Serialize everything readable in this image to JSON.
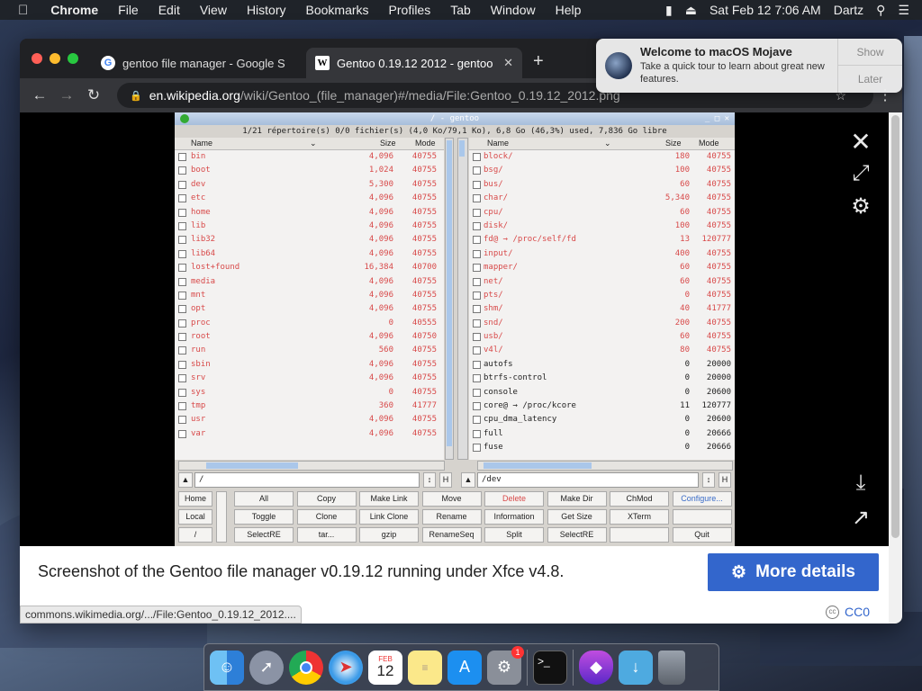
{
  "menubar": {
    "app": "Chrome",
    "items": [
      "File",
      "Edit",
      "View",
      "History",
      "Bookmarks",
      "Profiles",
      "Tab",
      "Window",
      "Help"
    ],
    "clock": "Sat Feb 12  7:06 AM",
    "user": "Dartz"
  },
  "browser": {
    "tabs": [
      {
        "title": "gentoo file manager - Google S",
        "favicon": "G"
      },
      {
        "title": "Gentoo 0.19.12 2012 - gentoo",
        "favicon": "W"
      }
    ],
    "url_host": "en.wikipedia.org",
    "url_path": "/wiki/Gentoo_(file_manager)#/media/File:Gentoo_0.19.12_2012.png"
  },
  "viewer": {
    "caption": "Screenshot of the Gentoo file manager v0.19.12 running under Xfce v4.8.",
    "more_details": "More details",
    "license": "CC0",
    "status_url": "commons.wikimedia.org/.../File:Gentoo_0.19.12_2012...."
  },
  "notification": {
    "title": "Welcome to macOS Mojave",
    "body": "Take a quick tour to learn about great new features.",
    "show": "Show",
    "later": "Later"
  },
  "gentoo": {
    "title": "/ - gentoo",
    "info": "1/21 répertoire(s) 0/0 fichier(s) (4,0 Ko/79,1 Ko), 6,8 Go (46,3%) used, 7,836 Go libre",
    "col_name": "Name",
    "col_size": "Size",
    "col_mode": "Mode",
    "left_path": "/",
    "right_path": "/dev",
    "h_label": "H",
    "left_files": [
      [
        "bin",
        "4,096",
        "40755"
      ],
      [
        "boot",
        "1,024",
        "40755"
      ],
      [
        "dev",
        "5,300",
        "40755"
      ],
      [
        "etc",
        "4,096",
        "40755"
      ],
      [
        "home",
        "4,096",
        "40755"
      ],
      [
        "lib",
        "4,096",
        "40755"
      ],
      [
        "lib32",
        "4,096",
        "40755"
      ],
      [
        "lib64",
        "4,096",
        "40755"
      ],
      [
        "lost+found",
        "16,384",
        "40700"
      ],
      [
        "media",
        "4,096",
        "40755"
      ],
      [
        "mnt",
        "4,096",
        "40755"
      ],
      [
        "opt",
        "4,096",
        "40755"
      ],
      [
        "proc",
        "0",
        "40555"
      ],
      [
        "root",
        "4,096",
        "40750"
      ],
      [
        "run",
        "560",
        "40755"
      ],
      [
        "sbin",
        "4,096",
        "40755"
      ],
      [
        "srv",
        "4,096",
        "40755"
      ],
      [
        "sys",
        "0",
        "40755"
      ],
      [
        "tmp",
        "360",
        "41777"
      ],
      [
        "usr",
        "4,096",
        "40755"
      ],
      [
        "var",
        "4,096",
        "40755"
      ]
    ],
    "right_files": [
      [
        "block/",
        "180",
        "40755",
        "r"
      ],
      [
        "bsg/",
        "100",
        "40755",
        "r"
      ],
      [
        "bus/",
        "60",
        "40755",
        "r"
      ],
      [
        "char/",
        "5,340",
        "40755",
        "r"
      ],
      [
        "cpu/",
        "60",
        "40755",
        "r"
      ],
      [
        "disk/",
        "100",
        "40755",
        "r"
      ],
      [
        "fd@ → /proc/self/fd",
        "13",
        "120777",
        "r"
      ],
      [
        "input/",
        "400",
        "40755",
        "r"
      ],
      [
        "mapper/",
        "60",
        "40755",
        "r"
      ],
      [
        "net/",
        "60",
        "40755",
        "r"
      ],
      [
        "pts/",
        "0",
        "40755",
        "r"
      ],
      [
        "shm/",
        "40",
        "41777",
        "r"
      ],
      [
        "snd/",
        "200",
        "40755",
        "r"
      ],
      [
        "usb/",
        "60",
        "40755",
        "r"
      ],
      [
        "v4l/",
        "80",
        "40755",
        "r"
      ],
      [
        "autofs",
        "0",
        "20000",
        "b"
      ],
      [
        "btrfs-control",
        "0",
        "20000",
        "b"
      ],
      [
        "console",
        "0",
        "20600",
        "b"
      ],
      [
        "core@ → /proc/kcore",
        "11",
        "120777",
        "b"
      ],
      [
        "cpu_dma_latency",
        "0",
        "20600",
        "b"
      ],
      [
        "full",
        "0",
        "20666",
        "b"
      ],
      [
        "fuse",
        "0",
        "20666",
        "b"
      ]
    ],
    "nav_buttons": [
      "Home",
      "Local",
      "/"
    ],
    "buttons": [
      [
        "All",
        "Copy",
        "Make Link",
        "Move",
        "Delete",
        "Make Dir",
        "ChMod",
        "Configure..."
      ],
      [
        "Toggle",
        "Clone",
        "Link Clone",
        "Rename",
        "Information",
        "Get Size",
        "XTerm",
        ""
      ],
      [
        "SelectRE",
        "tar...",
        "gzip",
        "RenameSeq",
        "Split",
        "SelectRE",
        "",
        "Quit"
      ]
    ]
  },
  "dock": {
    "calendar_month": "FEB",
    "calendar_day": "12",
    "badge": "1"
  }
}
